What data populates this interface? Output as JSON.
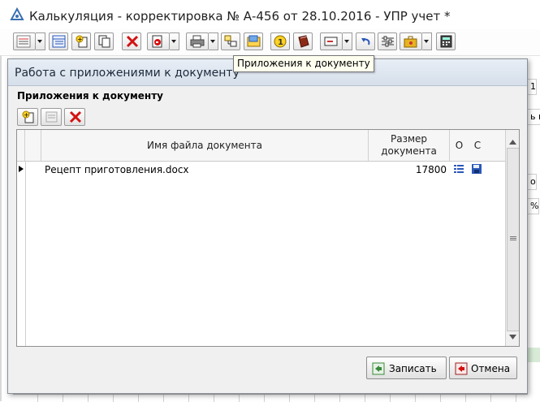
{
  "window": {
    "title": "Калькуляция - корректировка № А-456 от 28.10.2016 - УПР учет *"
  },
  "toolbar": {
    "tooltip": "Приложения к документу",
    "buttons": [
      "list-menu-icon",
      "table-icon",
      "add-copy-icon",
      "copy-icon",
      "delete-icon",
      "post-icon",
      "print-icon",
      "structure-icon",
      "attachments-icon",
      "number-one-icon",
      "book-icon",
      "email-icon",
      "undo-icon",
      "settings-icon",
      "briefcase-icon",
      "calculator-icon"
    ]
  },
  "background": {
    "right_cells": [
      "1",
      "ь п",
      "о",
      "%"
    ]
  },
  "dialog": {
    "title": "Работа с приложениями к документу",
    "subtitle": "Приложения к документу",
    "table": {
      "headers": {
        "file_name": "Имя файла документа",
        "size": "Размер документа",
        "open": "О",
        "save": "С"
      },
      "rows": [
        {
          "file_name": "Рецепт приготовления.docx",
          "size": "17800"
        }
      ]
    },
    "buttons": {
      "save": "Записать",
      "cancel": "Отмена"
    }
  },
  "colors": {
    "delete": "#d41111",
    "accent": "#2b58b8",
    "dialog_head": "#d6dfea"
  }
}
